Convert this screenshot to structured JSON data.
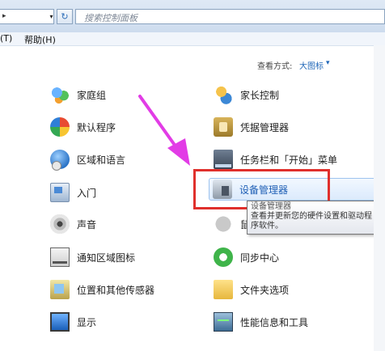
{
  "address": {
    "arrow": "▸",
    "dropdown": "▾",
    "refresh": "↻",
    "search_placeholder": "搜索控制面板"
  },
  "menu": {
    "left_partial": "(T)",
    "help": "帮助(H)"
  },
  "view_by": {
    "label": "查看方式:",
    "value": "大图标",
    "caret": "▾"
  },
  "items_left": [
    {
      "label": "家庭组",
      "icon": "homegroup-icon"
    },
    {
      "label": "默认程序",
      "icon": "default-programs-icon"
    },
    {
      "label": "区域和语言",
      "icon": "region-language-icon"
    },
    {
      "label": "入门",
      "icon": "getting-started-icon"
    },
    {
      "label": "声音",
      "icon": "sound-icon"
    },
    {
      "label": "通知区域图标",
      "icon": "notification-area-icon"
    },
    {
      "label": "位置和其他传感器",
      "icon": "location-sensors-icon"
    },
    {
      "label": "显示",
      "icon": "display-icon"
    }
  ],
  "items_right": [
    {
      "label": "家长控制",
      "icon": "parental-controls-icon"
    },
    {
      "label": "凭据管理器",
      "icon": "credential-manager-icon"
    },
    {
      "label": "任务栏和「开始」菜单",
      "icon": "taskbar-start-icon"
    },
    {
      "label": "设备管理器",
      "icon": "device-manager-icon"
    },
    {
      "label": "鼠",
      "icon": "mouse-icon"
    },
    {
      "label": "同步中心",
      "icon": "sync-center-icon"
    },
    {
      "label": "文件夹选项",
      "icon": "folder-options-icon"
    },
    {
      "label": "性能信息和工具",
      "icon": "performance-icon"
    }
  ],
  "tooltip": {
    "title": "设备管理器",
    "description": "查看并更新您的硬件设置和驱动程序软件。"
  },
  "colors": {
    "highlight_border": "#e0302c",
    "arrow": "#e23ce6",
    "link_blue": "#1f66b8"
  }
}
